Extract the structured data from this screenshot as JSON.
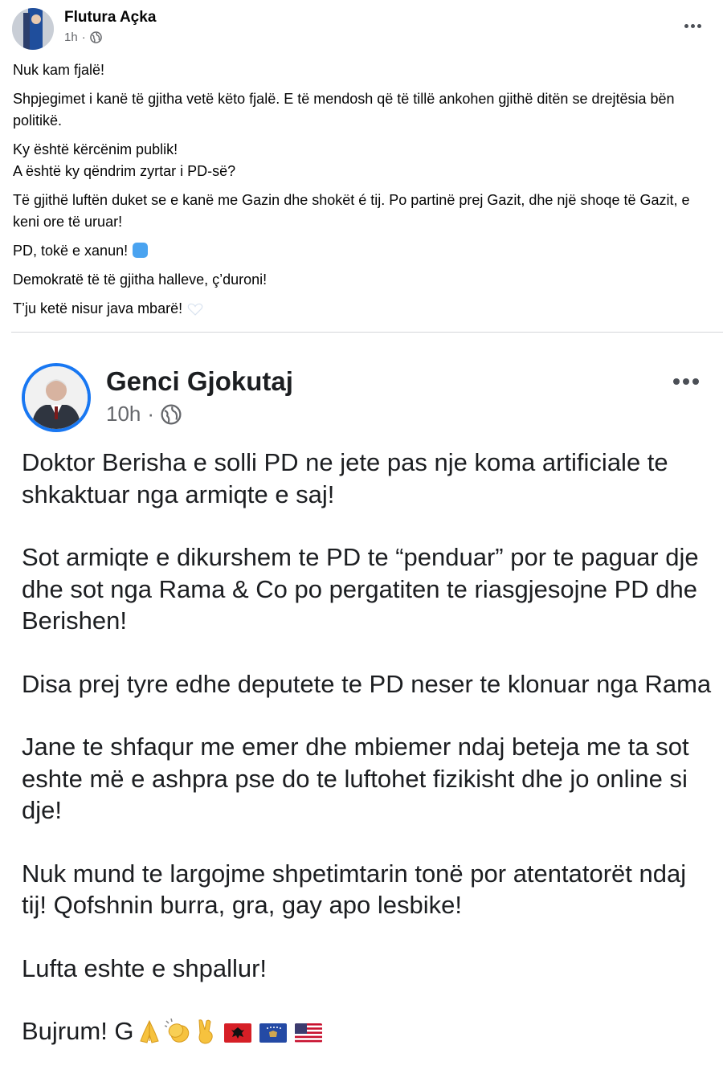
{
  "post1": {
    "author": "Flutura Açka",
    "time": "1h",
    "paragraphs": [
      "Nuk kam fjalë!",
      "Shpjegimet i kanë të gjitha vetë këto fjalë. E të mendosh që të tillë ankohen gjithë ditën se drejtësia bën politikë.",
      "Ky është kërcënim publik!",
      "A është ky qëndrim zyrtar i PD-së?",
      "Të gjithë luftën duket se e kanë me Gazin dhe shokët é tij. Po partinë prej Gazit, dhe një shoqe të Gazit, e keni ore të uruar!",
      "PD, tokë e xanun!",
      "Demokratë të të gjitha halleve, ç’duroni!",
      "T’ju ketë nisur java mbarë!"
    ]
  },
  "post2": {
    "author": "Genci Gjokutaj",
    "time": "10h",
    "paragraphs": [
      "Doktor Berisha e solli PD ne jete pas nje koma artificiale te shkaktuar nga armiqte e saj!",
      "Sot armiqte e dikurshem te PD te “penduar” por te paguar dje dhe sot nga Rama & Co po pergatiten te riasgjesojne PD dhe Berishen!",
      "Disa prej tyre edhe deputete te PD  neser te klonuar nga Rama",
      "Jane te shfaqur me emer dhe mbiemer ndaj beteja me ta sot eshte më e ashpra pse do te luftohet fizikisht dhe jo online si dje!",
      "Nuk mund te largojme shpetimtarin tonë por atentatorët ndaj tij! Qofshnin burra, gra, gay apo lesbike!",
      "Lufta eshte e shpallur!",
      "Bujrum! G"
    ],
    "closing_icons": [
      "folded-hands-emoji",
      "clapping-hands-emoji",
      "victory-hand-emoji",
      "albania-flag",
      "kosovo-flag",
      "usa-flag"
    ]
  },
  "colors": {
    "link_blue": "#1877f2",
    "meta_gray": "#65676b",
    "text": "#050505"
  }
}
